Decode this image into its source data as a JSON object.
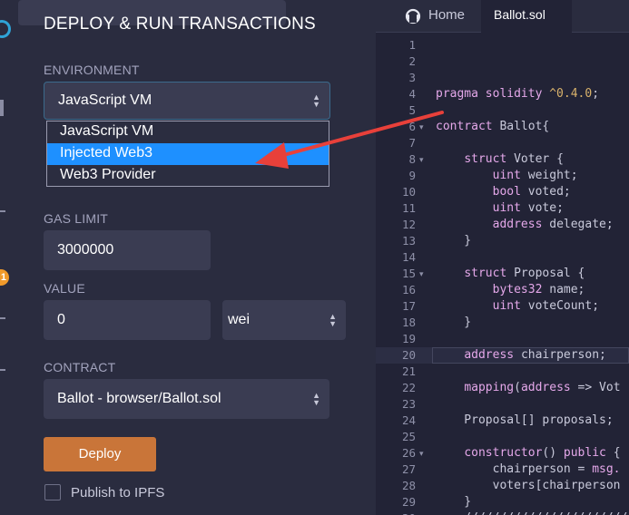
{
  "panel": {
    "title": "DEPLOY & RUN TRANSACTIONS",
    "environment_label": "ENVIRONMENT",
    "environment_value": "JavaScript VM",
    "environment_options": [
      "JavaScript VM",
      "Injected Web3",
      "Web3 Provider"
    ],
    "selected_option_index": 1,
    "gas_limit_label": "GAS LIMIT",
    "gas_limit_value": "3000000",
    "value_label": "VALUE",
    "value_amount": "0",
    "value_unit": "wei",
    "contract_label": "CONTRACT",
    "contract_value": "Ballot - browser/Ballot.sol",
    "deploy_label": "Deploy",
    "ipfs_label": "Publish to IPFS",
    "ipfs_checked": false
  },
  "rail": {
    "badge_count": "1"
  },
  "editor": {
    "tabs": [
      {
        "label": "Home",
        "icon": "remix-logo-icon"
      },
      {
        "label": "Ballot.sol",
        "active": true
      }
    ],
    "highlighted_line": 20,
    "line_numbers": [
      "1",
      "2",
      "3",
      "4",
      "5",
      "6",
      "7",
      "8",
      "9",
      "10",
      "11",
      "12",
      "13",
      "14",
      "15",
      "16",
      "17",
      "18",
      "19",
      "20",
      "21",
      "22",
      "23",
      "24",
      "25",
      "26",
      "27",
      "28",
      "29",
      "30"
    ],
    "fold_lines": [
      6,
      8,
      15,
      26
    ],
    "code_lines": [
      [],
      [],
      [],
      [
        [
          "kw",
          "pragma solidity "
        ],
        [
          "num",
          "^0.4.0"
        ],
        [
          "pl",
          ";"
        ]
      ],
      [],
      [
        [
          "kw",
          "contract "
        ],
        [
          "pl",
          "Ballot{"
        ]
      ],
      [],
      [
        [
          "pl",
          "    "
        ],
        [
          "kw",
          "struct "
        ],
        [
          "pl",
          "Voter {"
        ]
      ],
      [
        [
          "pl",
          "        "
        ],
        [
          "ty",
          "uint "
        ],
        [
          "pl",
          "weight;"
        ]
      ],
      [
        [
          "pl",
          "        "
        ],
        [
          "ty",
          "bool "
        ],
        [
          "pl",
          "voted;"
        ]
      ],
      [
        [
          "pl",
          "        "
        ],
        [
          "ty",
          "uint "
        ],
        [
          "pl",
          "vote;"
        ]
      ],
      [
        [
          "pl",
          "        "
        ],
        [
          "ty",
          "address "
        ],
        [
          "pl",
          "delegate;"
        ]
      ],
      [
        [
          "pl",
          "    }"
        ]
      ],
      [],
      [
        [
          "pl",
          "    "
        ],
        [
          "kw",
          "struct "
        ],
        [
          "pl",
          "Proposal {"
        ]
      ],
      [
        [
          "pl",
          "        "
        ],
        [
          "ty",
          "bytes32 "
        ],
        [
          "pl",
          "name;"
        ]
      ],
      [
        [
          "pl",
          "        "
        ],
        [
          "ty",
          "uint "
        ],
        [
          "pl",
          "voteCount;"
        ]
      ],
      [
        [
          "pl",
          "    }"
        ]
      ],
      [],
      [
        [
          "pl",
          "    "
        ],
        [
          "ty",
          "address "
        ],
        [
          "pl",
          "chairperson;"
        ]
      ],
      [],
      [
        [
          "pl",
          "    "
        ],
        [
          "kw",
          "mapping"
        ],
        [
          "pl",
          "("
        ],
        [
          "ty",
          "address"
        ],
        [
          "pl",
          " => Vot"
        ]
      ],
      [],
      [
        [
          "pl",
          "    Proposal[] proposals;"
        ]
      ],
      [],
      [
        [
          "pl",
          "    "
        ],
        [
          "kw",
          "constructor"
        ],
        [
          "pl",
          "() "
        ],
        [
          "kw",
          "public "
        ],
        [
          "pl",
          "{"
        ]
      ],
      [
        [
          "pl",
          "        chairperson = "
        ],
        [
          "kw",
          "msg."
        ]
      ],
      [
        [
          "pl",
          "        voters[chairperson"
        ]
      ],
      [
        [
          "pl",
          "    }"
        ]
      ],
      [
        [
          "pl",
          "    ////////////////////////"
        ]
      ]
    ]
  },
  "colors": {
    "panel_bg": "#2a2c3f",
    "editor_bg": "#222336",
    "field_bg": "#3a3c52",
    "selected_option": "#1e90ff",
    "deploy_button": "#c97539",
    "annotation_arrow": "#e8403a",
    "keyword": "#e5a8ea",
    "number": "#d9b26b"
  }
}
